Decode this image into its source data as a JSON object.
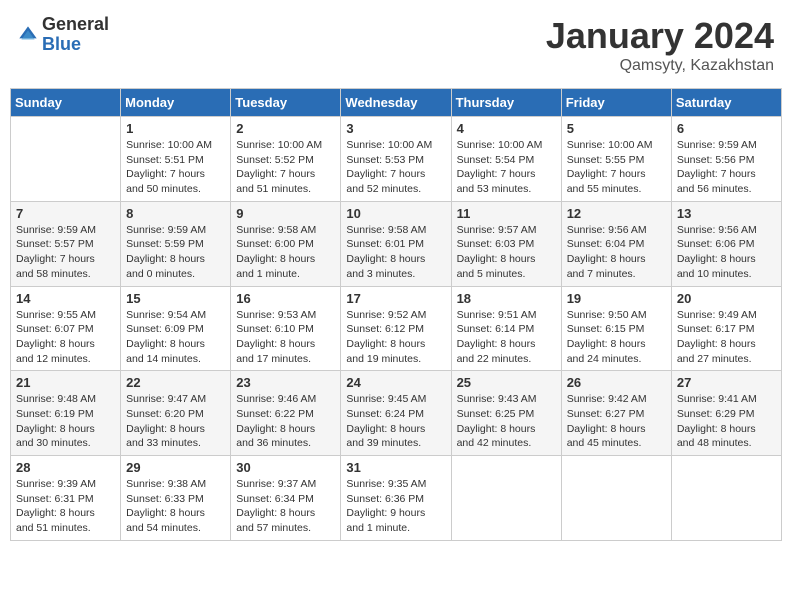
{
  "logo": {
    "general": "General",
    "blue": "Blue"
  },
  "header": {
    "month": "January 2024",
    "location": "Qamsyty, Kazakhstan"
  },
  "weekdays": [
    "Sunday",
    "Monday",
    "Tuesday",
    "Wednesday",
    "Thursday",
    "Friday",
    "Saturday"
  ],
  "weeks": [
    [
      {
        "day": "",
        "info": ""
      },
      {
        "day": "1",
        "info": "Sunrise: 10:00 AM\nSunset: 5:51 PM\nDaylight: 7 hours\nand 50 minutes."
      },
      {
        "day": "2",
        "info": "Sunrise: 10:00 AM\nSunset: 5:52 PM\nDaylight: 7 hours\nand 51 minutes."
      },
      {
        "day": "3",
        "info": "Sunrise: 10:00 AM\nSunset: 5:53 PM\nDaylight: 7 hours\nand 52 minutes."
      },
      {
        "day": "4",
        "info": "Sunrise: 10:00 AM\nSunset: 5:54 PM\nDaylight: 7 hours\nand 53 minutes."
      },
      {
        "day": "5",
        "info": "Sunrise: 10:00 AM\nSunset: 5:55 PM\nDaylight: 7 hours\nand 55 minutes."
      },
      {
        "day": "6",
        "info": "Sunrise: 9:59 AM\nSunset: 5:56 PM\nDaylight: 7 hours\nand 56 minutes."
      }
    ],
    [
      {
        "day": "7",
        "info": "Sunrise: 9:59 AM\nSunset: 5:57 PM\nDaylight: 7 hours\nand 58 minutes."
      },
      {
        "day": "8",
        "info": "Sunrise: 9:59 AM\nSunset: 5:59 PM\nDaylight: 8 hours\nand 0 minutes."
      },
      {
        "day": "9",
        "info": "Sunrise: 9:58 AM\nSunset: 6:00 PM\nDaylight: 8 hours\nand 1 minute."
      },
      {
        "day": "10",
        "info": "Sunrise: 9:58 AM\nSunset: 6:01 PM\nDaylight: 8 hours\nand 3 minutes."
      },
      {
        "day": "11",
        "info": "Sunrise: 9:57 AM\nSunset: 6:03 PM\nDaylight: 8 hours\nand 5 minutes."
      },
      {
        "day": "12",
        "info": "Sunrise: 9:56 AM\nSunset: 6:04 PM\nDaylight: 8 hours\nand 7 minutes."
      },
      {
        "day": "13",
        "info": "Sunrise: 9:56 AM\nSunset: 6:06 PM\nDaylight: 8 hours\nand 10 minutes."
      }
    ],
    [
      {
        "day": "14",
        "info": "Sunrise: 9:55 AM\nSunset: 6:07 PM\nDaylight: 8 hours\nand 12 minutes."
      },
      {
        "day": "15",
        "info": "Sunrise: 9:54 AM\nSunset: 6:09 PM\nDaylight: 8 hours\nand 14 minutes."
      },
      {
        "day": "16",
        "info": "Sunrise: 9:53 AM\nSunset: 6:10 PM\nDaylight: 8 hours\nand 17 minutes."
      },
      {
        "day": "17",
        "info": "Sunrise: 9:52 AM\nSunset: 6:12 PM\nDaylight: 8 hours\nand 19 minutes."
      },
      {
        "day": "18",
        "info": "Sunrise: 9:51 AM\nSunset: 6:14 PM\nDaylight: 8 hours\nand 22 minutes."
      },
      {
        "day": "19",
        "info": "Sunrise: 9:50 AM\nSunset: 6:15 PM\nDaylight: 8 hours\nand 24 minutes."
      },
      {
        "day": "20",
        "info": "Sunrise: 9:49 AM\nSunset: 6:17 PM\nDaylight: 8 hours\nand 27 minutes."
      }
    ],
    [
      {
        "day": "21",
        "info": "Sunrise: 9:48 AM\nSunset: 6:19 PM\nDaylight: 8 hours\nand 30 minutes."
      },
      {
        "day": "22",
        "info": "Sunrise: 9:47 AM\nSunset: 6:20 PM\nDaylight: 8 hours\nand 33 minutes."
      },
      {
        "day": "23",
        "info": "Sunrise: 9:46 AM\nSunset: 6:22 PM\nDaylight: 8 hours\nand 36 minutes."
      },
      {
        "day": "24",
        "info": "Sunrise: 9:45 AM\nSunset: 6:24 PM\nDaylight: 8 hours\nand 39 minutes."
      },
      {
        "day": "25",
        "info": "Sunrise: 9:43 AM\nSunset: 6:25 PM\nDaylight: 8 hours\nand 42 minutes."
      },
      {
        "day": "26",
        "info": "Sunrise: 9:42 AM\nSunset: 6:27 PM\nDaylight: 8 hours\nand 45 minutes."
      },
      {
        "day": "27",
        "info": "Sunrise: 9:41 AM\nSunset: 6:29 PM\nDaylight: 8 hours\nand 48 minutes."
      }
    ],
    [
      {
        "day": "28",
        "info": "Sunrise: 9:39 AM\nSunset: 6:31 PM\nDaylight: 8 hours\nand 51 minutes."
      },
      {
        "day": "29",
        "info": "Sunrise: 9:38 AM\nSunset: 6:33 PM\nDaylight: 8 hours\nand 54 minutes."
      },
      {
        "day": "30",
        "info": "Sunrise: 9:37 AM\nSunset: 6:34 PM\nDaylight: 8 hours\nand 57 minutes."
      },
      {
        "day": "31",
        "info": "Sunrise: 9:35 AM\nSunset: 6:36 PM\nDaylight: 9 hours\nand 1 minute."
      },
      {
        "day": "",
        "info": ""
      },
      {
        "day": "",
        "info": ""
      },
      {
        "day": "",
        "info": ""
      }
    ]
  ]
}
